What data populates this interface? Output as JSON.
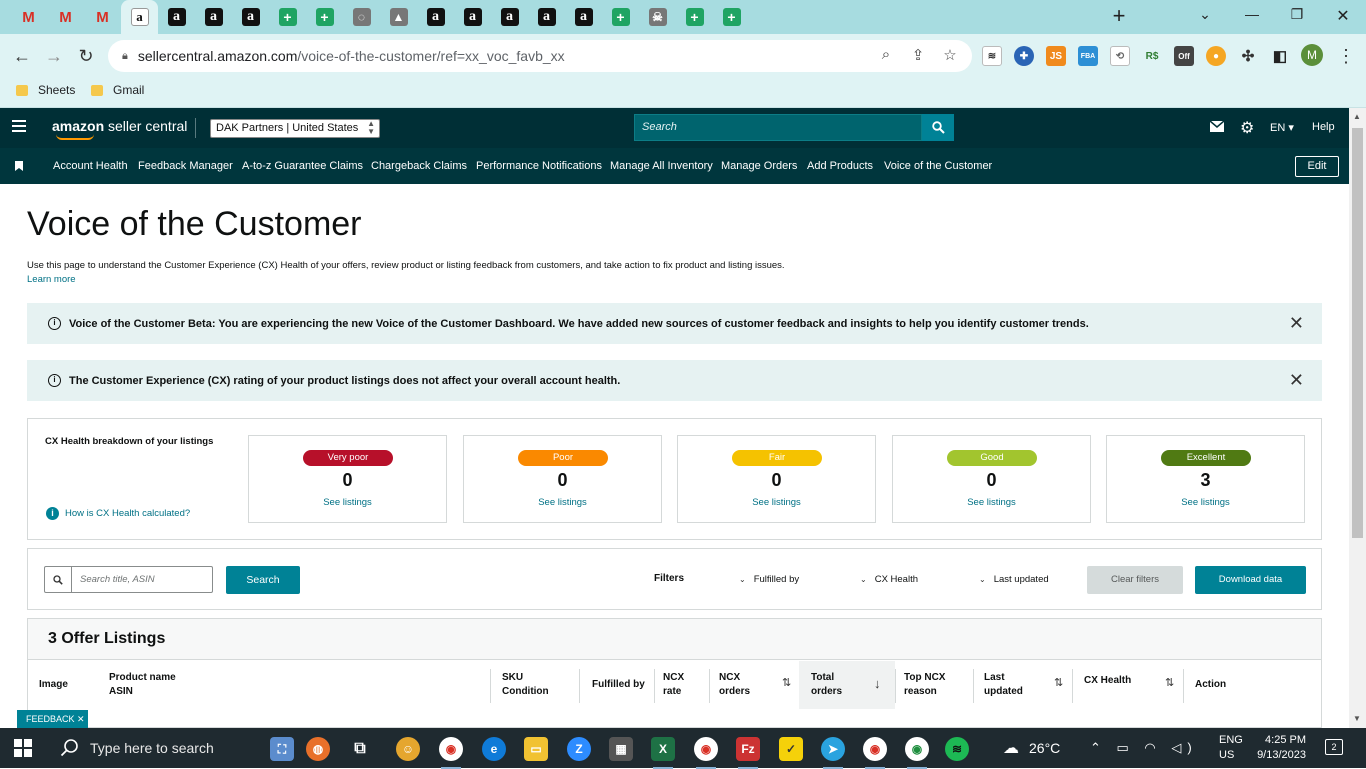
{
  "browser": {
    "tabs": [
      {
        "icon": "gmail-icon",
        "glyph": "M"
      },
      {
        "icon": "gmail-icon",
        "glyph": "M"
      },
      {
        "icon": "gmail-icon",
        "glyph": "M"
      },
      {
        "icon": "amazon-icon",
        "glyph": "a"
      },
      {
        "icon": "amazon-icon",
        "glyph": "a"
      },
      {
        "icon": "amazon-icon",
        "glyph": "a"
      },
      {
        "icon": "amazon-icon",
        "glyph": "a"
      },
      {
        "icon": "sheets-icon",
        "glyph": "+"
      },
      {
        "icon": "sheets-icon",
        "glyph": "+"
      },
      {
        "icon": "generic-icon",
        "glyph": "◌"
      },
      {
        "icon": "drive-icon",
        "glyph": "▲"
      },
      {
        "icon": "amazon-icon",
        "glyph": "a"
      },
      {
        "icon": "amazon-icon",
        "glyph": "a"
      },
      {
        "icon": "amazon-icon",
        "glyph": "a"
      },
      {
        "icon": "amazon-icon",
        "glyph": "a"
      },
      {
        "icon": "amazon-icon",
        "glyph": "a"
      },
      {
        "icon": "sheets-icon",
        "glyph": "+"
      },
      {
        "icon": "pirate-icon",
        "glyph": "☠"
      },
      {
        "icon": "sheets-icon",
        "glyph": "+"
      },
      {
        "icon": "sheets-icon",
        "glyph": "+"
      }
    ],
    "url_host": "sellercentral.amazon.com",
    "url_path": "/voice-of-the-customer/ref=xx_voc_favb_xx",
    "bookmarks": [
      "Sheets",
      "Gmail"
    ],
    "profile_initial": "M"
  },
  "header": {
    "logo_main": "amazon",
    "logo_sub": "seller central",
    "account_name": "DAK Partners",
    "account_region": "United States",
    "search_placeholder": "Search",
    "language": "EN",
    "help": "Help"
  },
  "nav": {
    "links": [
      "Account Health",
      "Feedback Manager",
      "A-to-z Guarantee Claims",
      "Chargeback Claims",
      "Performance Notifications",
      "Manage All Inventory",
      "Manage Orders",
      "Add Products",
      "Voice of the Customer"
    ],
    "edit": "Edit"
  },
  "page": {
    "title": "Voice of the Customer",
    "description": "Use this page to understand the Customer Experience (CX) Health of your offers, review product or listing feedback from customers, and take action to fix product and listing issues.",
    "learn_more": "Learn more"
  },
  "banners": [
    {
      "text": "Voice of the Customer Beta: You are experiencing the new Voice of the Customer Dashboard. We have added new sources of customer feedback and insights to help you identify customer trends."
    },
    {
      "text": "The Customer Experience (CX) rating of your product listings does not affect your overall account health."
    }
  ],
  "cx_health": {
    "title": "CX Health breakdown of your listings",
    "how_link": "How is CX Health calculated?",
    "ratings": [
      {
        "label": "Very poor",
        "count": "0",
        "link": "See listings",
        "color": "#b7102a"
      },
      {
        "label": "Poor",
        "count": "0",
        "link": "See listings",
        "color": "#fa8900"
      },
      {
        "label": "Fair",
        "count": "0",
        "link": "See listings",
        "color": "#f5c200"
      },
      {
        "label": "Good",
        "count": "0",
        "link": "See listings",
        "color": "#a2c52e"
      },
      {
        "label": "Excellent",
        "count": "3",
        "link": "See listings",
        "color": "#507a13"
      }
    ]
  },
  "filters": {
    "search_placeholder": "Search title, ASIN",
    "search_button": "Search",
    "label": "Filters",
    "dropdowns": [
      "Fulfilled by",
      "CX Health",
      "Last updated"
    ],
    "clear": "Clear filters",
    "download": "Download data"
  },
  "listings": {
    "title": "3 Offer Listings",
    "columns": [
      {
        "line1": "Image",
        "line2": ""
      },
      {
        "line1": "Product name",
        "line2": "ASIN"
      },
      {
        "line1": "SKU",
        "line2": "Condition"
      },
      {
        "line1": "Fulfilled by",
        "line2": ""
      },
      {
        "line1": "NCX",
        "line2": "rate"
      },
      {
        "line1": "NCX",
        "line2": "orders"
      },
      {
        "line1": "Total",
        "line2": "orders"
      },
      {
        "line1": "Top NCX",
        "line2": "reason"
      },
      {
        "line1": "Last",
        "line2": "updated"
      },
      {
        "line1": "CX Health",
        "line2": ""
      },
      {
        "line1": "Action",
        "line2": ""
      }
    ]
  },
  "feedback_tab": "FEEDBACK",
  "taskbar": {
    "search_placeholder": "Type here to search",
    "weather": "26°C",
    "lang_line1": "ENG",
    "lang_line2": "US",
    "time": "4:25 PM",
    "date": "9/13/2023",
    "notifications": "2"
  }
}
